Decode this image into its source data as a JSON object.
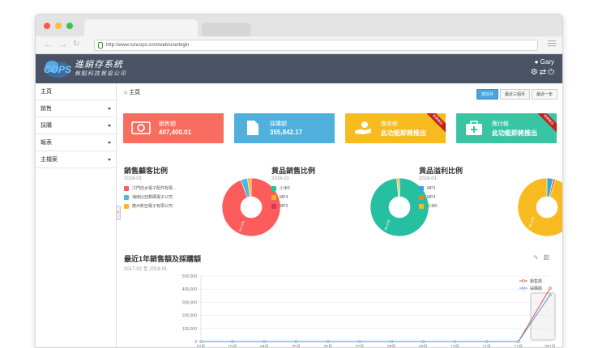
{
  "browser": {
    "url": "http://www.runcops.com/web/userlogin"
  },
  "app": {
    "logo": "COPS",
    "title": "進銷存系統",
    "subtitle": "焦點科技貿易公司",
    "user": "Gary"
  },
  "sidebar": {
    "items": [
      {
        "label": "主頁",
        "has_caret": false
      },
      {
        "label": "銷售",
        "has_caret": true
      },
      {
        "label": "採購",
        "has_caret": true
      },
      {
        "label": "報表",
        "has_caret": true
      },
      {
        "label": "主檔案",
        "has_caret": true
      }
    ],
    "handle": "‹"
  },
  "breadcrumb": "主頁",
  "range_buttons": [
    {
      "label": "當前月",
      "active": true
    },
    {
      "label": "最近三個月",
      "active": false
    },
    {
      "label": "最近一年",
      "active": false
    }
  ],
  "cards": [
    {
      "label": "銷售額",
      "value": "407,400.01",
      "color": "#f76e60",
      "ribbon": ""
    },
    {
      "label": "採購額",
      "value": "355,842.17",
      "color": "#4fb0de",
      "ribbon": ""
    },
    {
      "label": "應收帳",
      "value": "此功能即將推出",
      "color": "#f7bb1f",
      "ribbon": "即將推出"
    },
    {
      "label": "應付帳",
      "value": "此功能即將推出",
      "color": "#39c4a4",
      "ribbon": "即將推出"
    }
  ],
  "chart_data": [
    {
      "type": "pie",
      "title": "銷售顧客比例",
      "subtitle": "2018-01",
      "labels": [
        "江門亞太電子配件有限...",
        "海南比亞數碼電子公司",
        "廣州新亞電子有限公司"
      ],
      "values": [
        94.12,
        3.86,
        2.02
      ],
      "colors": [
        "#fd5c5c",
        "#4db6e4",
        "#f7bb1f"
      ],
      "slice_labels": [
        "94.12%",
        "",
        ""
      ]
    },
    {
      "type": "pie",
      "title": "貨品銷售比例",
      "subtitle": "2018-01",
      "labels": [
        "小米6",
        "MP4",
        "MP3"
      ],
      "values": [
        98.47,
        1.02,
        0.51
      ],
      "colors": [
        "#26bfa0",
        "#f7bb1f",
        "#d33a5a"
      ],
      "slice_labels": [
        "98.47%",
        "",
        ""
      ]
    },
    {
      "type": "pie",
      "title": "貨品溢利比例",
      "subtitle": "2018-01",
      "labels": [
        "MP3",
        "MP4",
        "小米6"
      ],
      "values": [
        3.35,
        1.53,
        95.12
      ],
      "colors": [
        "#2eaadf",
        "#f57c31",
        "#f7bb1f"
      ],
      "slice_labels": [
        "",
        "",
        "95.12%"
      ]
    },
    {
      "type": "line",
      "title": "最近1年銷售額及採購額",
      "subtitle": "2017-02 至 2018-01",
      "x": [
        "02月",
        "03月",
        "04月",
        "05月",
        "06月",
        "07月",
        "08月",
        "09月",
        "10月",
        "11月",
        "12月",
        "001月"
      ],
      "ylim": [
        0,
        500000
      ],
      "yticks": [
        "0",
        "100,000",
        "200,000",
        "300,000",
        "400,000",
        "500,000"
      ],
      "series": [
        {
          "name": "銷售額",
          "color": "#e0403f",
          "values": [
            0,
            0,
            0,
            0,
            0,
            0,
            0,
            0,
            0,
            0,
            0,
            407400.01
          ]
        },
        {
          "name": "採購額",
          "color": "#4a8fd6",
          "values": [
            0,
            0,
            0,
            0,
            0,
            0,
            0,
            0,
            0,
            0,
            0,
            355842.17
          ]
        }
      ]
    }
  ]
}
